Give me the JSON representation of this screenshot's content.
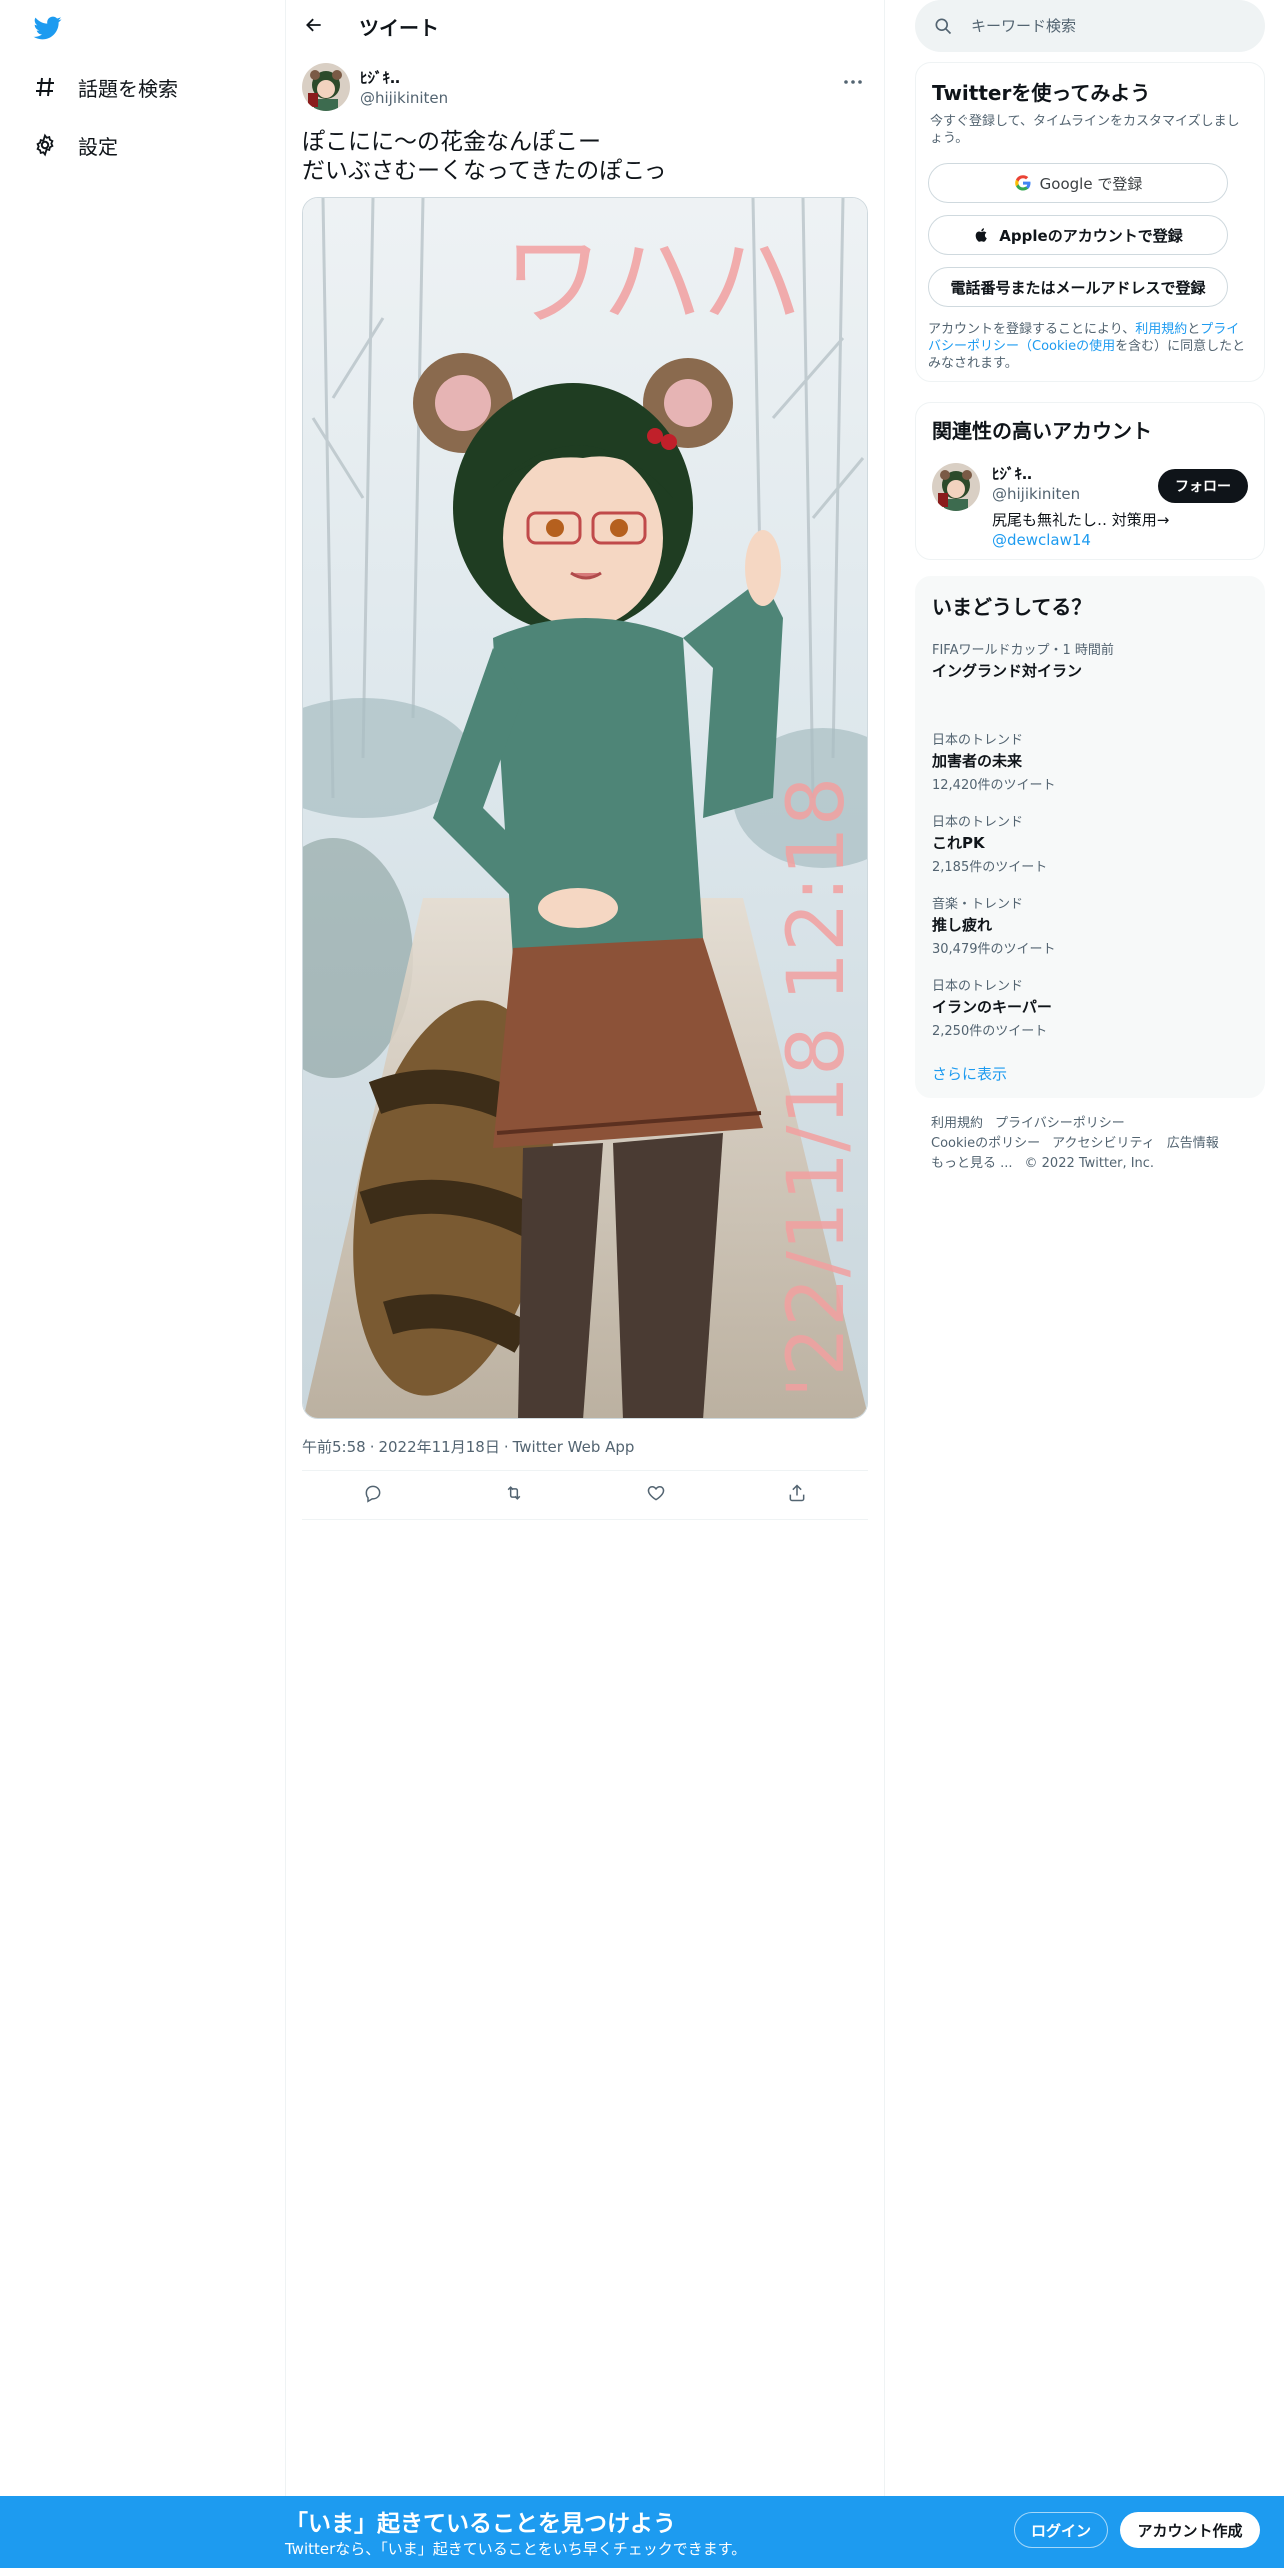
{
  "nav": {
    "logo_icon": "twitter-bird-icon",
    "items": [
      {
        "label": "話題を検索",
        "icon": "hashtag-icon"
      },
      {
        "label": "設定",
        "icon": "gear-icon"
      }
    ]
  },
  "header": {
    "title": "ツイート"
  },
  "tweet": {
    "author_name": "ﾋｼﾞｷ‥",
    "author_handle": "@hijikiniten",
    "text": "ぽこにに～の花金なんぽこー\nだいぶさむーくなってきたのぽこっ",
    "image_overlay_top": "ワハハ",
    "image_overlay_side": "'22/11/18 12:18",
    "time": "午前5:58",
    "date": "2022年11月18日",
    "source": "Twitter Web App",
    "separator": "·"
  },
  "search": {
    "placeholder": "キーワード検索"
  },
  "signup": {
    "title": "Twitterを使ってみよう",
    "desc": "今すぐ登録して、タイムラインをカスタマイズしましょう。",
    "google_label": "Google で登録",
    "apple_label": "Appleのアカウントで登録",
    "phone_label": "電話番号またはメールアドレスで登録",
    "terms_pre": "アカウントを登録することにより、",
    "terms_link1": "利用規約",
    "terms_mid1": "と",
    "terms_link2": "プライバシーポリシー（Cookieの使用",
    "terms_post": "を含む）に同意したとみなされます。"
  },
  "related": {
    "title": "関連性の高いアカウント",
    "name": "ﾋｼﾞｷ‥",
    "handle": "@hijikiniten",
    "bio": "尻尾も無礼たし‥ 対策用→",
    "bio_link": "@dewclaw14",
    "follow_label": "フォロー"
  },
  "trends": {
    "title": "いまどうしてる？",
    "items": [
      {
        "category": "FIFAワールドカップ・1 時間前",
        "name": "イングランド対イラン",
        "count": ""
      },
      {
        "category": "日本のトレンド",
        "name": "加害者の未来",
        "count": "12,420件のツイート"
      },
      {
        "category": "日本のトレンド",
        "name": "これPK",
        "count": "2,185件のツイート"
      },
      {
        "category": "音楽・トレンド",
        "name": "推し疲れ",
        "count": "30,479件のツイート"
      },
      {
        "category": "日本のトレンド",
        "name": "イランのキーパー",
        "count": "2,250件のツイート"
      }
    ],
    "show_more": "さらに表示"
  },
  "footer": {
    "links": [
      "利用規約",
      "プライバシーポリシー",
      "Cookieのポリシー",
      "アクセシビリティ",
      "広告情報",
      "もっと見る ..."
    ],
    "copyright": "© 2022 Twitter, Inc."
  },
  "bottom_bar": {
    "title": "「いま」起きていることを見つけよう",
    "subtitle": "Twitterなら、「いま」起きていることをいち早くチェックできます。",
    "login_label": "ログイン",
    "signup_label": "アカウント作成"
  },
  "colors": {
    "accent": "#1d9bf0",
    "text": "#0f1419",
    "muted": "#536471"
  }
}
